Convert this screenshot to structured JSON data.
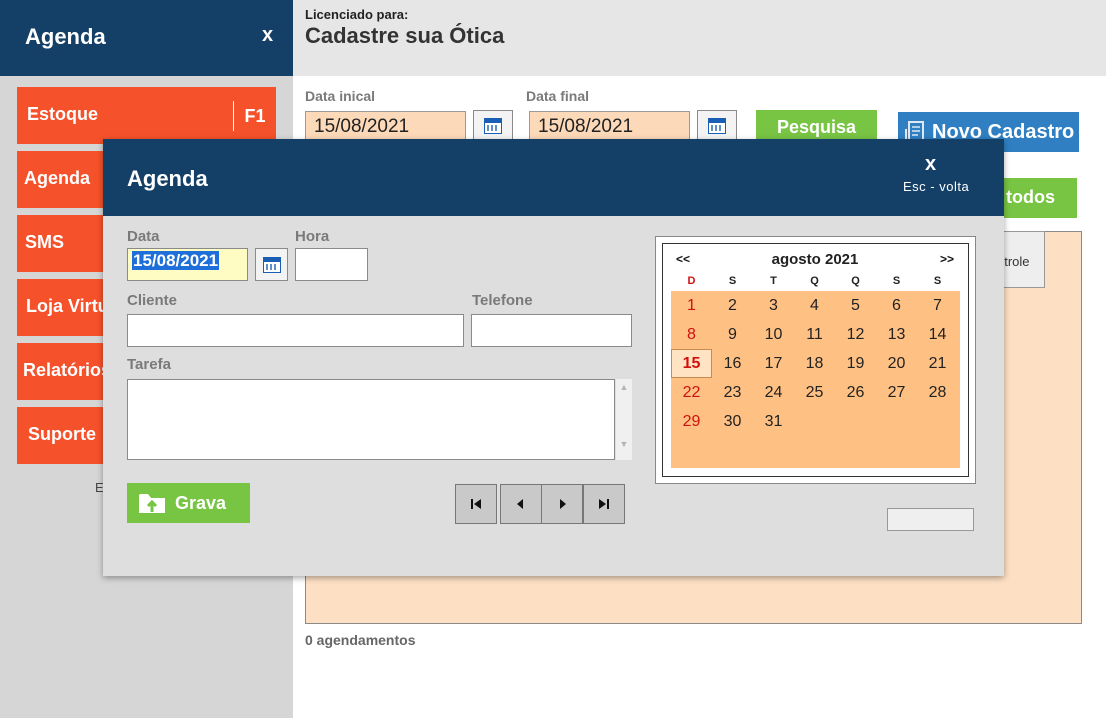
{
  "sidebar": {
    "title": "Agenda",
    "close": "x",
    "items": [
      {
        "label": "Estoque",
        "key": "F1"
      },
      {
        "label": "Agenda"
      },
      {
        "label": "SMS"
      },
      {
        "label": "Loja Virtual"
      },
      {
        "label": "Relatórios"
      },
      {
        "label": "Suporte"
      }
    ],
    "footer": "E"
  },
  "header": {
    "license_label": "Licenciado para:",
    "license_name": "Cadastre sua Ótica"
  },
  "filters": {
    "start_label": "Data inical",
    "start_value": "15/08/2021",
    "end_label": "Data final",
    "end_value": "15/08/2021",
    "search_button": "Pesquisa",
    "new_button": "Novo Cadastro",
    "all_button": "todos",
    "tab_stub": "ntrole"
  },
  "results": {
    "count_text": "0 agendamentos"
  },
  "modal": {
    "title": "Agenda",
    "close": "x",
    "esc_hint": "Esc - volta",
    "data_label": "Data",
    "data_value": "15/08/2021",
    "hora_label": "Hora",
    "hora_value": "",
    "cliente_label": "Cliente",
    "cliente_value": "",
    "telefone_label": "Telefone",
    "telefone_value": "",
    "tarefa_label": "Tarefa",
    "tarefa_value": "",
    "save_button": "Grava"
  },
  "calendar": {
    "prev": "<<",
    "next": ">>",
    "month": "agosto 2021",
    "weekdays": [
      "D",
      "S",
      "T",
      "Q",
      "Q",
      "S",
      "S"
    ],
    "selected_day": 15,
    "weeks": [
      [
        "1",
        "2",
        "3",
        "4",
        "5",
        "6",
        "7"
      ],
      [
        "8",
        "9",
        "10",
        "11",
        "12",
        "13",
        "14"
      ],
      [
        "15",
        "16",
        "17",
        "18",
        "19",
        "20",
        "21"
      ],
      [
        "22",
        "23",
        "24",
        "25",
        "26",
        "27",
        "28"
      ],
      [
        "29",
        "30",
        "31",
        "",
        "",
        "",
        ""
      ]
    ]
  },
  "colors": {
    "navy": "#143f66",
    "orange": "#f5512a",
    "green": "#78c443",
    "blue": "#2f7fc2",
    "peach": "#fcd9b8",
    "calendar_bg": "#ffc183"
  }
}
